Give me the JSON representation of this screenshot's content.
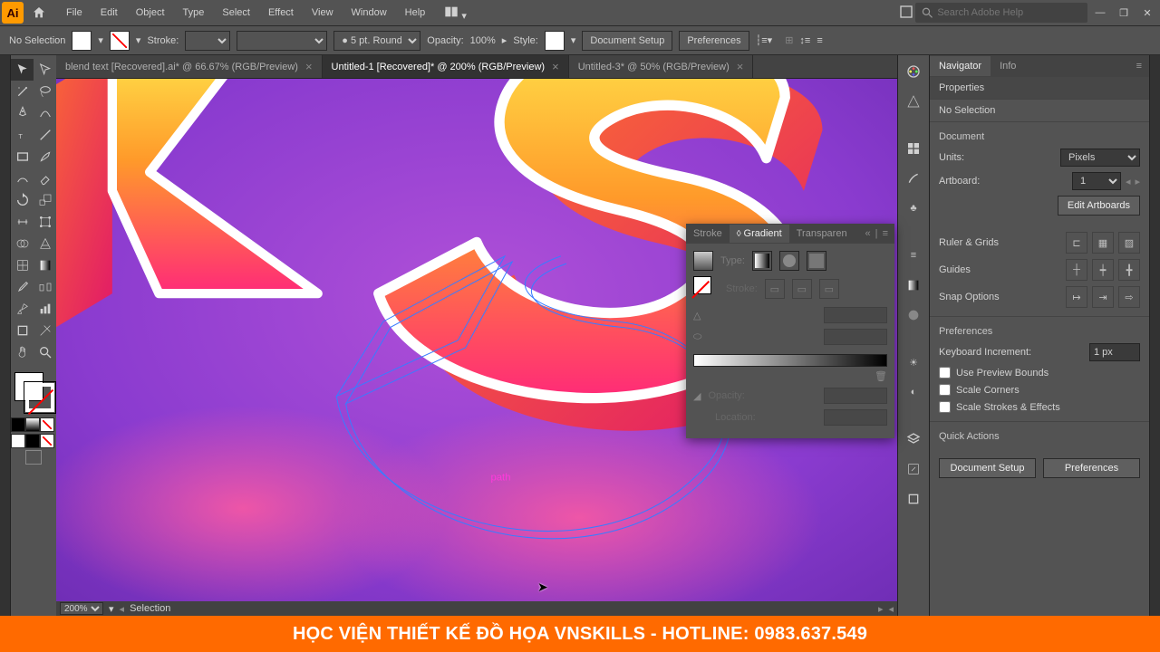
{
  "menu": {
    "items": [
      "File",
      "Edit",
      "Object",
      "Type",
      "Select",
      "Effect",
      "View",
      "Window",
      "Help"
    ]
  },
  "search": {
    "placeholder": "Search Adobe Help"
  },
  "control": {
    "selection": "No Selection",
    "strokeLabel": "Stroke:",
    "strokeRound": "5 pt. Round",
    "opacityLabel": "Opacity:",
    "opacityValue": "100%",
    "styleLabel": "Style:",
    "docSetup": "Document Setup",
    "prefs": "Preferences"
  },
  "tabs": [
    {
      "label": "blend text [Recovered].ai* @ 66.67% (RGB/Preview)",
      "active": false
    },
    {
      "label": "Untitled-1 [Recovered]* @ 200% (RGB/Preview)",
      "active": true
    },
    {
      "label": "Untitled-3* @ 50% (RGB/Preview)",
      "active": false
    }
  ],
  "statusbar": {
    "zoom": "200%",
    "mode": "Selection"
  },
  "pathLabel": "path",
  "gradient": {
    "tabs": [
      "Stroke",
      "Gradient",
      "Transparen"
    ],
    "type": "Type:",
    "stroke": "Stroke:",
    "opacity": "Opacity:",
    "location": "Location:"
  },
  "panels": {
    "nav": "Navigator",
    "info": "Info",
    "properties": "Properties",
    "noSelection": "No Selection",
    "document": "Document",
    "units": "Units:",
    "unitsVal": "Pixels",
    "artboards": "Artboard:",
    "artVal": "1",
    "editArtboards": "Edit Artboards",
    "ruler": "Ruler & Grids",
    "guides": "Guides",
    "snap": "Snap Options",
    "prefs": "Preferences",
    "keyboard": "Keyboard Increment:",
    "keyboardVal": "1 px",
    "usePreview": "Use Preview Bounds",
    "scaleCorners": "Scale Corners",
    "scaleStrokes": "Scale Strokes & Effects",
    "quick": "Quick Actions",
    "docSetup": "Document Setup",
    "prefBtn": "Preferences"
  },
  "banner": "HỌC VIỆN THIẾT KẾ ĐỒ HỌA VNSKILLS - HOTLINE: 0983.637.549"
}
